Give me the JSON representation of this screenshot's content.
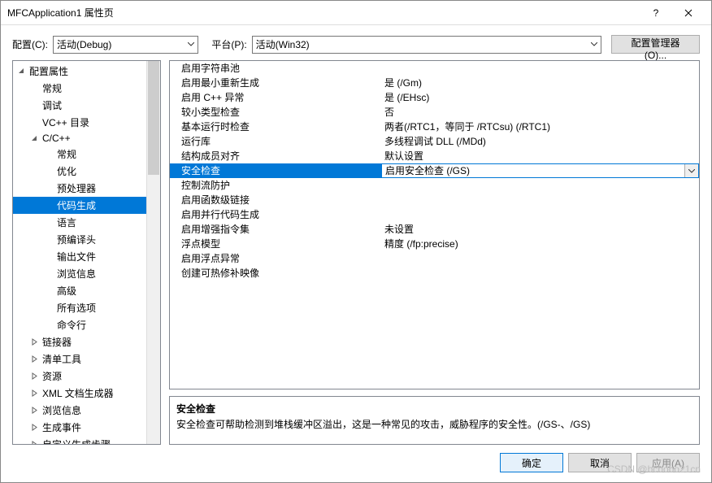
{
  "title": "MFCApplication1 属性页",
  "toolbar": {
    "config_label": "配置(C):",
    "config_value": "活动(Debug)",
    "platform_label": "平台(P):",
    "platform_value": "活动(Win32)",
    "manager_btn": "配置管理器(O)..."
  },
  "tree": [
    {
      "label": "配置属性",
      "indent": 0,
      "twisty": "▱",
      "expanded": true
    },
    {
      "label": "常规",
      "indent": 1
    },
    {
      "label": "调试",
      "indent": 1
    },
    {
      "label": "VC++ 目录",
      "indent": 1
    },
    {
      "label": "C/C++",
      "indent": 1,
      "twisty": "▱",
      "expanded": true
    },
    {
      "label": "常规",
      "indent": 2
    },
    {
      "label": "优化",
      "indent": 2
    },
    {
      "label": "预处理器",
      "indent": 2
    },
    {
      "label": "代码生成",
      "indent": 2,
      "selected": true
    },
    {
      "label": "语言",
      "indent": 2
    },
    {
      "label": "预编译头",
      "indent": 2
    },
    {
      "label": "输出文件",
      "indent": 2
    },
    {
      "label": "浏览信息",
      "indent": 2
    },
    {
      "label": "高级",
      "indent": 2
    },
    {
      "label": "所有选项",
      "indent": 2
    },
    {
      "label": "命令行",
      "indent": 2
    },
    {
      "label": "链接器",
      "indent": 1,
      "twisty": "▷"
    },
    {
      "label": "清单工具",
      "indent": 1,
      "twisty": "▷"
    },
    {
      "label": "资源",
      "indent": 1,
      "twisty": "▷"
    },
    {
      "label": "XML 文档生成器",
      "indent": 1,
      "twisty": "▷"
    },
    {
      "label": "浏览信息",
      "indent": 1,
      "twisty": "▷"
    },
    {
      "label": "生成事件",
      "indent": 1,
      "twisty": "▷"
    },
    {
      "label": "自定义生成步骤",
      "indent": 1,
      "twisty": "▷"
    }
  ],
  "grid": [
    {
      "k": "启用字符串池",
      "v": ""
    },
    {
      "k": "启用最小重新生成",
      "v": "是 (/Gm)"
    },
    {
      "k": "启用 C++ 异常",
      "v": "是 (/EHsc)"
    },
    {
      "k": "较小类型检查",
      "v": "否"
    },
    {
      "k": "基本运行时检查",
      "v": "两者(/RTC1，等同于 /RTCsu) (/RTC1)"
    },
    {
      "k": "运行库",
      "v": "多线程调试 DLL (/MDd)"
    },
    {
      "k": "结构成员对齐",
      "v": "默认设置"
    },
    {
      "k": "安全检查",
      "v": "启用安全检查 (/GS)",
      "selected": true
    },
    {
      "k": "控制流防护",
      "v": ""
    },
    {
      "k": "启用函数级链接",
      "v": ""
    },
    {
      "k": "启用并行代码生成",
      "v": ""
    },
    {
      "k": "启用增强指令集",
      "v": "未设置"
    },
    {
      "k": "浮点模型",
      "v": "精度 (/fp:precise)"
    },
    {
      "k": "启用浮点异常",
      "v": ""
    },
    {
      "k": "创建可热修补映像",
      "v": ""
    }
  ],
  "desc": {
    "title": "安全检查",
    "body": "安全检查可帮助检测到堆栈缓冲区溢出，这是一种常见的攻击，威胁程序的安全性。(/GS-、/GS)"
  },
  "footer": {
    "ok": "确定",
    "cancel": "取消",
    "apply": "应用(A)"
  },
  "watermark": "CSDN @bcbobo21cn"
}
